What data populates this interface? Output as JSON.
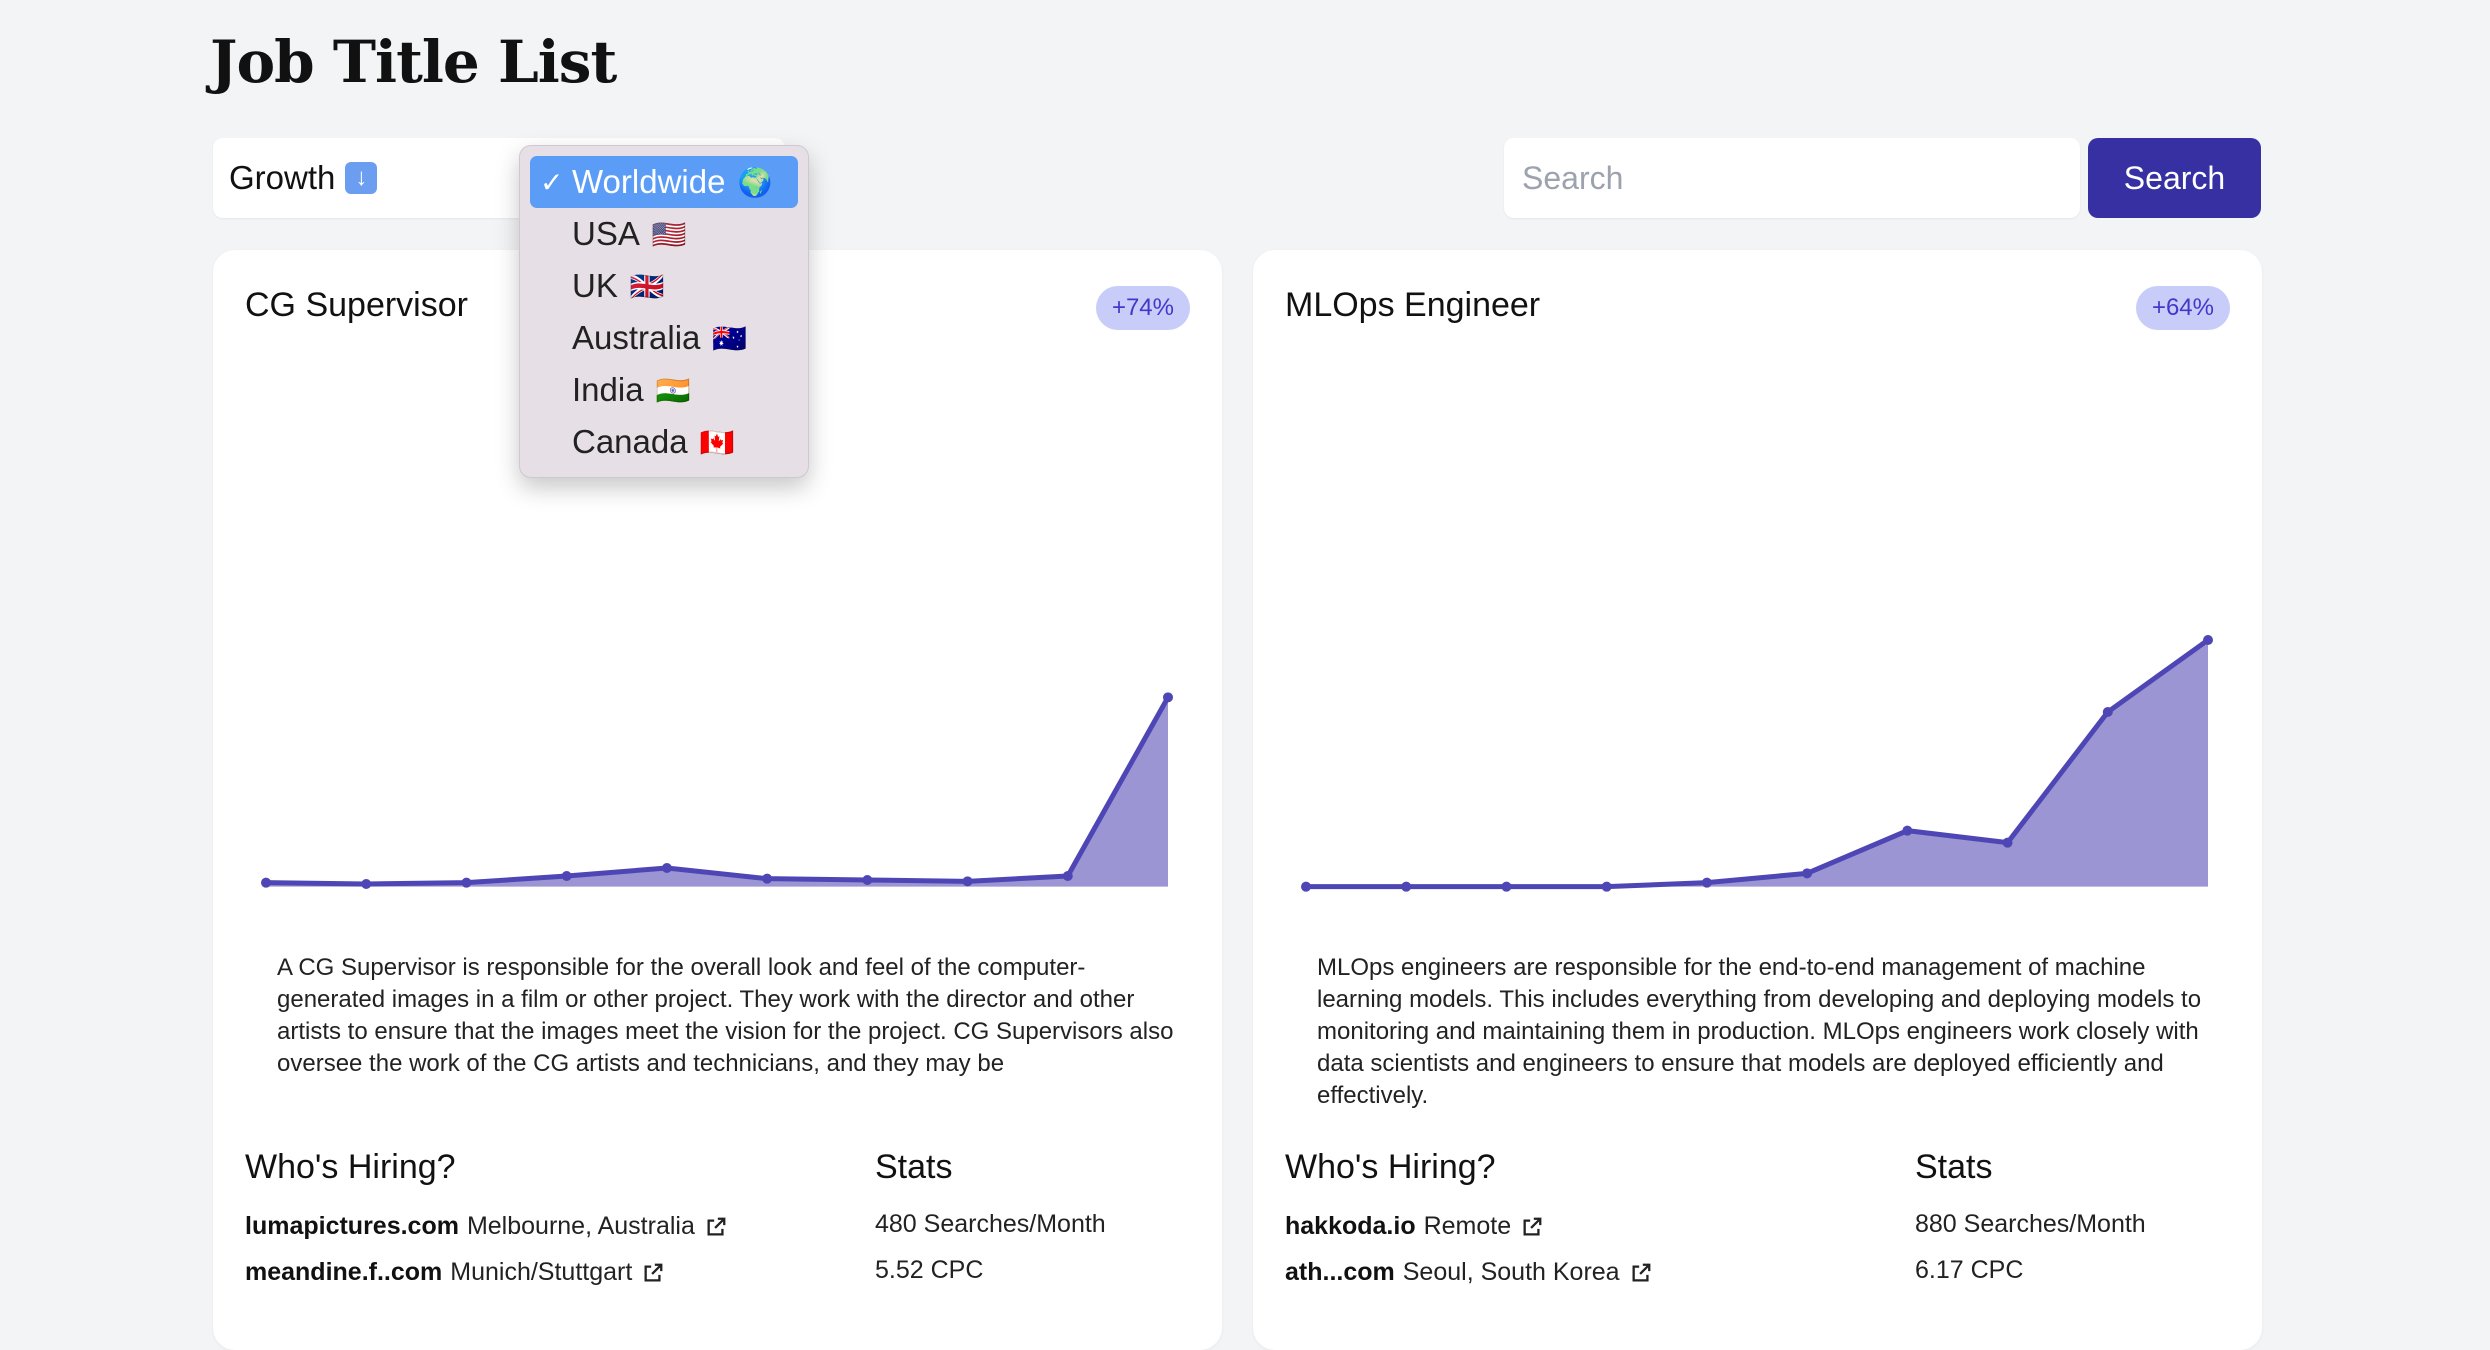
{
  "page": {
    "title": "Job Title List"
  },
  "sort_select": {
    "label": "Growth",
    "icon": "down-arrow-icon"
  },
  "country_dropdown": {
    "options": [
      {
        "label": "Worldwide",
        "flag": "🌍",
        "selected": true
      },
      {
        "label": "USA",
        "flag": "🇺🇸",
        "selected": false
      },
      {
        "label": "UK",
        "flag": "🇬🇧",
        "selected": false
      },
      {
        "label": "Australia",
        "flag": "🇦🇺",
        "selected": false
      },
      {
        "label": "India",
        "flag": "🇮🇳",
        "selected": false
      },
      {
        "label": "Canada",
        "flag": "🇨🇦",
        "selected": false
      }
    ]
  },
  "search": {
    "placeholder": "Search",
    "button_label": "Search"
  },
  "colors": {
    "accent": "#3730a3",
    "chart_line": "#4f46b5",
    "chart_fill": "#9b95d4",
    "badge_bg": "#c7cdf8"
  },
  "cards": [
    {
      "title": "CG Supervisor",
      "growth": "+74%",
      "chart_data": {
        "type": "area",
        "values": [
          3,
          2,
          3,
          8,
          14,
          6,
          5,
          4,
          8,
          142
        ],
        "ylim": [
          -10,
          230
        ]
      },
      "description": "A CG Supervisor is responsible for the overall look and feel of the computer-generated images in a film or other project. They work with the director and other artists to ensure that the images meet the vision for the project. CG Supervisors also oversee the work of the CG artists and technicians, and they may be",
      "hiring_heading": "Who's Hiring?",
      "stats_heading": "Stats",
      "companies": [
        {
          "name": "lumapictures.com",
          "location": "Melbourne, Australia"
        },
        {
          "name": "meandine.f..com",
          "location": "Munich/Stuttgart"
        }
      ],
      "stats": [
        "480 Searches/Month",
        "5.52 CPC"
      ]
    },
    {
      "title": "MLOps Engineer",
      "growth": "+64%",
      "chart_data": {
        "type": "area",
        "values": [
          0,
          0,
          0,
          0,
          3,
          10,
          42,
          33,
          131,
          185
        ],
        "ylim": [
          -10,
          230
        ]
      },
      "description": "MLOps engineers are responsible for the end-to-end management of machine learning models. This includes everything from developing and deploying models to monitoring and maintaining them in production. MLOps engineers work closely with data scientists and engineers to ensure that models are deployed efficiently and effectively.",
      "hiring_heading": "Who's Hiring?",
      "stats_heading": "Stats",
      "companies": [
        {
          "name": "hakkoda.io",
          "location": "Remote"
        },
        {
          "name": "ath...com",
          "location": "Seoul, South Korea"
        }
      ],
      "stats": [
        "880 Searches/Month",
        "6.17 CPC"
      ]
    }
  ]
}
